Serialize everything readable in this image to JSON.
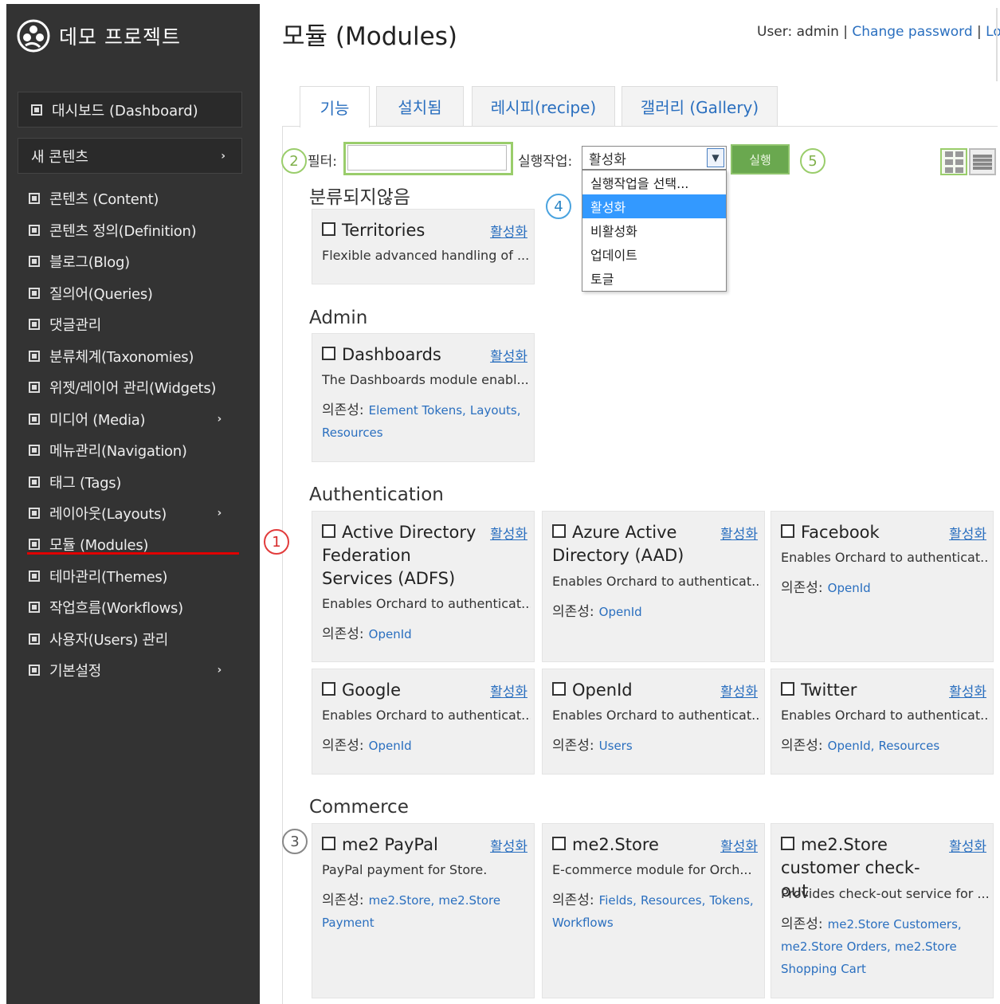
{
  "app": {
    "title": "데모 프로젝트"
  },
  "sidebar": {
    "dashboard": "대시보드 (Dashboard)",
    "new_content": "새 콘텐츠",
    "items": [
      {
        "label": "콘텐츠 (Content)",
        "has_sub": false
      },
      {
        "label": "콘텐츠 정의(Definition)",
        "has_sub": false
      },
      {
        "label": "블로그(Blog)",
        "has_sub": false
      },
      {
        "label": "질의어(Queries)",
        "has_sub": false
      },
      {
        "label": "댓글관리",
        "has_sub": false
      },
      {
        "label": "분류체계(Taxonomies)",
        "has_sub": false
      },
      {
        "label": "위젯/레이어 관리(Widgets)",
        "has_sub": false
      },
      {
        "label": "미디어 (Media)",
        "has_sub": true
      },
      {
        "label": "메뉴관리(Navigation)",
        "has_sub": false
      },
      {
        "label": "태그 (Tags)",
        "has_sub": false
      },
      {
        "label": "레이아웃(Layouts)",
        "has_sub": true
      },
      {
        "label": "모듈 (Modules)",
        "has_sub": false,
        "active": true
      },
      {
        "label": "테마관리(Themes)",
        "has_sub": false
      },
      {
        "label": "작업흐름(Workflows)",
        "has_sub": false
      },
      {
        "label": "사용자(Users) 관리",
        "has_sub": false
      },
      {
        "label": "기본설정",
        "has_sub": true
      }
    ]
  },
  "header": {
    "page_title": "모듈 (Modules)",
    "user_text": "User: admin",
    "sep": "|",
    "change_password": "Change password",
    "logout": "Lo"
  },
  "tabs": [
    "기능",
    "설치됨",
    "레시피(recipe)",
    "갤러리 (Gallery)"
  ],
  "toolbar": {
    "filter_label": "필터:",
    "filter_value": "",
    "action_label": "실행작업:",
    "action_selected": "활성화",
    "action_options": [
      "실행작업을 선택...",
      "활성화",
      "비활성화",
      "업데이트",
      "토글"
    ],
    "run_label": "실행"
  },
  "badges": [
    "1",
    "2",
    "3",
    "4",
    "5"
  ],
  "deps_label": "의존성:",
  "sections": [
    {
      "title": "분류되지않음",
      "cards": [
        {
          "title": "Territories",
          "enable": "활성화",
          "desc": "Flexible advanced handling of ...",
          "deps": []
        }
      ]
    },
    {
      "title": "Admin",
      "cards": [
        {
          "title": "Dashboards",
          "enable": "활성화",
          "desc": "The Dashboards module enabl...",
          "deps": [
            "Element Tokens,",
            "Layouts,",
            "Resources"
          ]
        }
      ]
    },
    {
      "title": "Authentication",
      "cards": [
        {
          "title": "Active Directory Federation Services (ADFS)",
          "enable": "활성화",
          "desc": "Enables Orchard to authenticat...",
          "deps": [
            "OpenId"
          ]
        },
        {
          "title": "Azure Active Directory (AAD)",
          "enable": "활성화",
          "desc": "Enables Orchard to authenticat...",
          "deps": [
            "OpenId"
          ]
        },
        {
          "title": "Facebook",
          "enable": "활성화",
          "desc": "Enables Orchard to authenticat...",
          "deps": [
            "OpenId"
          ]
        },
        {
          "title": "Google",
          "enable": "활성화",
          "desc": "Enables Orchard to authenticat...",
          "deps": [
            "OpenId"
          ]
        },
        {
          "title": "OpenId",
          "enable": "활성화",
          "desc": "Enables Orchard to authenticat...",
          "deps": [
            "Users"
          ]
        },
        {
          "title": "Twitter",
          "enable": "활성화",
          "desc": "Enables Orchard to authenticat...",
          "deps": [
            "OpenId,",
            "Resources"
          ]
        }
      ]
    },
    {
      "title": "Commerce",
      "cards": [
        {
          "title": "me2 PayPal",
          "enable": "활성화",
          "desc": "PayPal payment for Store.",
          "deps": [
            "me2.Store,",
            "me2.Store Payment"
          ]
        },
        {
          "title": "me2.Store",
          "enable": "활성화",
          "desc": "E-commerce module for Orch...",
          "deps": [
            "Fields,",
            "Resources,",
            "Tokens,",
            "Workflows"
          ]
        },
        {
          "title": "me2.Store customer check-out",
          "enable": "활성화",
          "desc": "Provides check-out service for ...",
          "deps": [
            "me2.Store Customers,",
            "me2.Store Orders,",
            "me2.Store Shopping Cart"
          ]
        }
      ]
    }
  ],
  "colors": {
    "sidebar_bg": "#333333",
    "link": "#2a6fbf",
    "accent_green": "#6aa84f",
    "active_underline": "#e00000"
  }
}
